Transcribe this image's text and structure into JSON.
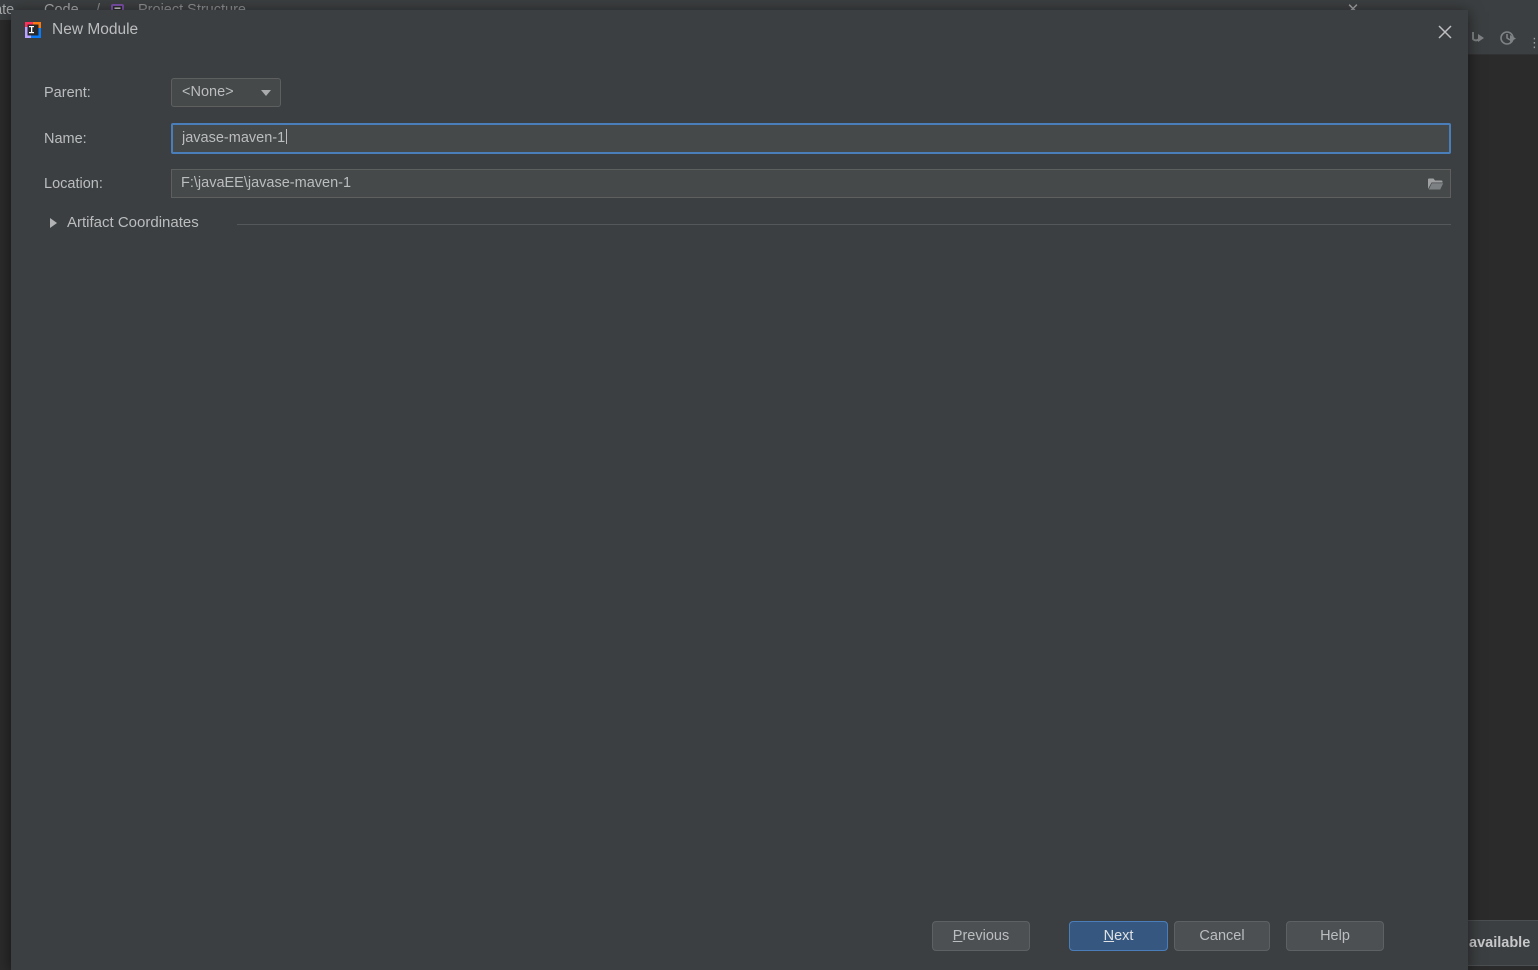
{
  "background": {
    "menu": {
      "navigate_label": "gate",
      "code_label_prefix": "",
      "code_label_mnemonic": "C",
      "code_label_rest": "ode",
      "separator": "/",
      "breadcrumb_icon": "project-structure-icon",
      "breadcrumb_label": "Project Structure"
    },
    "window_close_icon": "close-icon",
    "toolbar": {
      "run_icon": "run-icon",
      "debug_icon": "debug-icon",
      "more_icon": "more-icon"
    },
    "notification": {
      "text": "available"
    }
  },
  "dialog": {
    "icon": "intellij-idea-icon",
    "title": "New Module",
    "close_icon": "close-icon",
    "fields": {
      "parent": {
        "label": "Parent:",
        "value": "<None>",
        "options": [
          "<None>"
        ],
        "dropdown_icon": "chevron-down-icon"
      },
      "name": {
        "label": "Name:",
        "value": "javase-maven-1",
        "placeholder": "",
        "focused": true
      },
      "location": {
        "label": "Location:",
        "value": "F:\\javaEE\\javase-maven-1",
        "placeholder": "",
        "browse_icon": "folder-icon"
      }
    },
    "artifact_coordinates": {
      "label": "Artifact Coordinates",
      "expanded": false,
      "expander_icon": "chevron-right-icon"
    },
    "buttons": {
      "previous": {
        "mnemonic": "P",
        "rest": "revious"
      },
      "next": {
        "mnemonic": "N",
        "rest": "ext"
      },
      "cancel": {
        "label": "Cancel"
      },
      "help": {
        "label": "Help"
      }
    }
  },
  "colors": {
    "dialog_bg": "#3c3f41",
    "ide_bg": "#2b2b2b",
    "field_bg": "#45494a",
    "focus_border": "#4a7ebb",
    "primary_button": "#365880",
    "text": "#bbbdbf"
  }
}
